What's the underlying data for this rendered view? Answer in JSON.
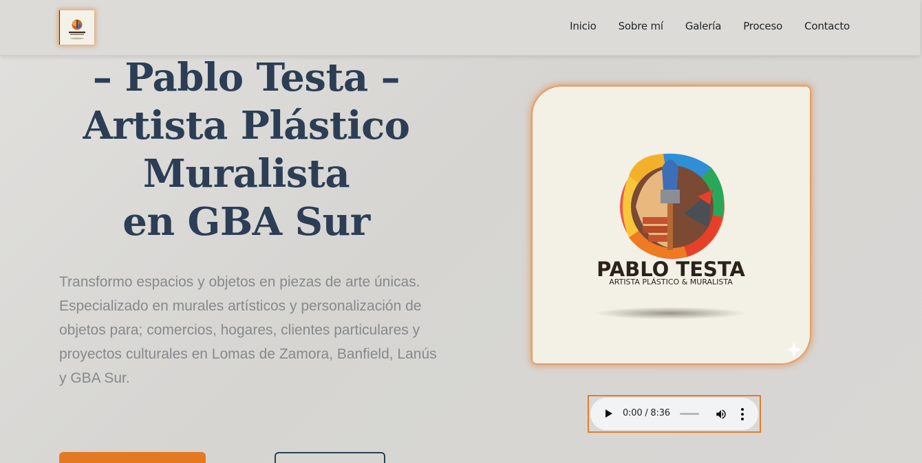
{
  "header": {
    "logo_text": [
      "PABLO TESTA",
      "ARTISTA PLÁSTICO & MURALISTA"
    ],
    "nav": [
      {
        "label": "Inicio"
      },
      {
        "label": "Sobre mí"
      },
      {
        "label": "Galería"
      },
      {
        "label": "Proceso"
      },
      {
        "label": "Contacto"
      }
    ]
  },
  "hero": {
    "title_lines": [
      "– Pablo Testa –",
      "Artista Plástico",
      "Muralista",
      "en GBA Sur"
    ],
    "description": "Transformo espacios y objetos en piezas de arte únicas. Especializado en murales artísticos y personalización de objetos para; comercios, hogares, clientes particulares y proyectos culturales en Lomas de Zamora, Banfield, Lanús y GBA Sur."
  },
  "card": {
    "brand_name": "PABLO TESTA",
    "brand_tagline": "ARTISTA PLÁSTICO & MURALISTA"
  },
  "audio": {
    "time": "0:00 / 8:36",
    "progress": 0
  },
  "icons": {
    "play": "play-icon",
    "volume": "volume-icon",
    "more": "more-vertical-icon"
  },
  "colors": {
    "accent": "#e37a22",
    "title": "#2c3e56",
    "text_muted": "#86898d",
    "background": "#d9d8d5"
  }
}
